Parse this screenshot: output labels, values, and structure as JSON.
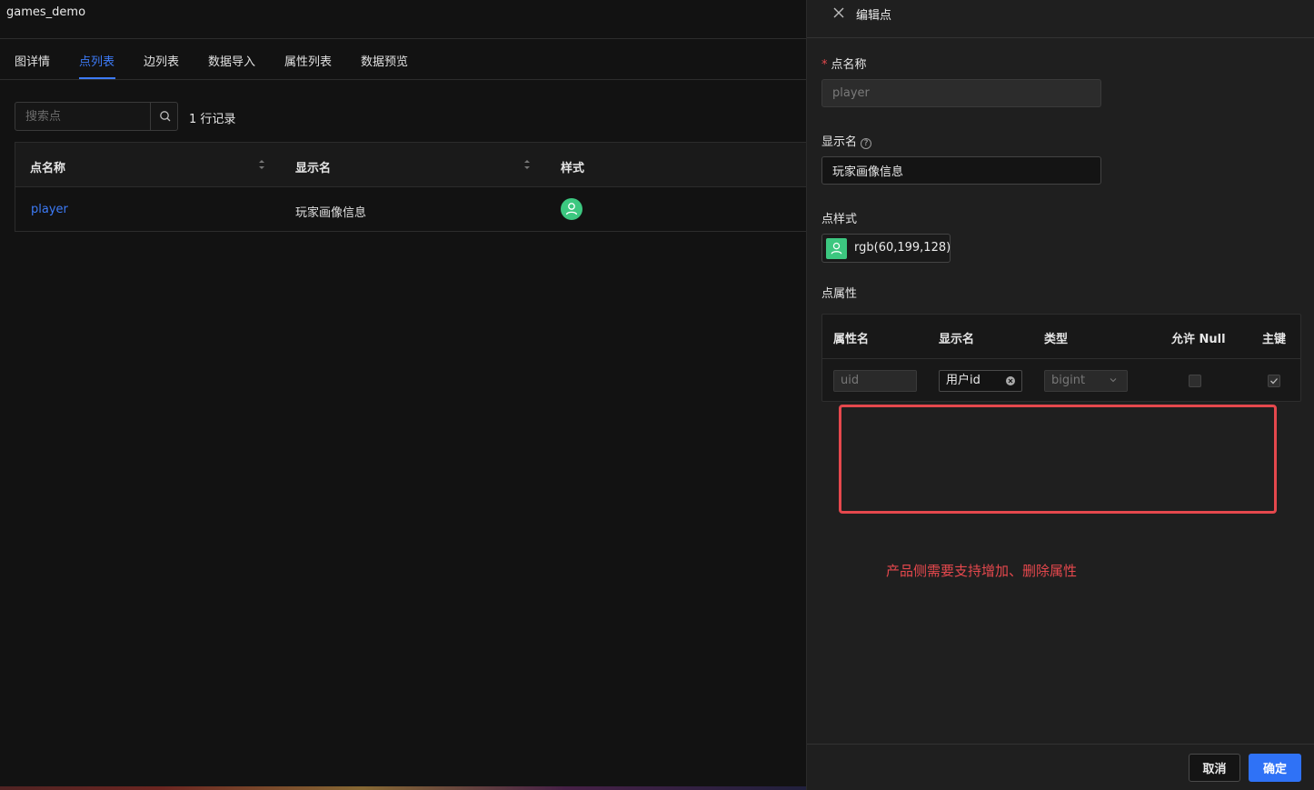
{
  "app": {
    "title": "games_demo"
  },
  "tabs": [
    {
      "label": "图详情"
    },
    {
      "label": "点列表"
    },
    {
      "label": "边列表"
    },
    {
      "label": "数据导入"
    },
    {
      "label": "属性列表"
    },
    {
      "label": "数据预览"
    }
  ],
  "active_tab": "点列表",
  "search": {
    "placeholder": "搜索点",
    "icon": "search-icon"
  },
  "record_count": "1 行记录",
  "table": {
    "columns": [
      "点名称",
      "显示名",
      "样式"
    ],
    "rows": [
      {
        "name": "player",
        "display_name": "玩家画像信息",
        "style_color": "#3cc780",
        "style_icon": "user-icon"
      }
    ]
  },
  "drawer": {
    "title": "编辑点",
    "fields": {
      "name_label": "点名称",
      "name_required_mark": "*",
      "name_value": "player",
      "display_label": "显示名",
      "display_value": "玩家画像信息",
      "style_label": "点样式",
      "style_value": "rgb(60,199,128)",
      "style_color": "#3cc780",
      "attrs_label": "点属性"
    },
    "attr_table": {
      "columns": [
        "属性名",
        "显示名",
        "类型",
        "允许 Null",
        "主键"
      ],
      "rows": [
        {
          "name": "uid",
          "display_name": "用户id",
          "type": "bigint",
          "allow_null": false,
          "primary_key": true
        }
      ]
    },
    "annotation": "产品侧需要支持增加、删除属性",
    "buttons": {
      "cancel": "取消",
      "ok": "确定"
    }
  },
  "colors": {
    "accent": "#3d7bf7",
    "annotation": "#e5484d",
    "node": "#3cc780"
  }
}
